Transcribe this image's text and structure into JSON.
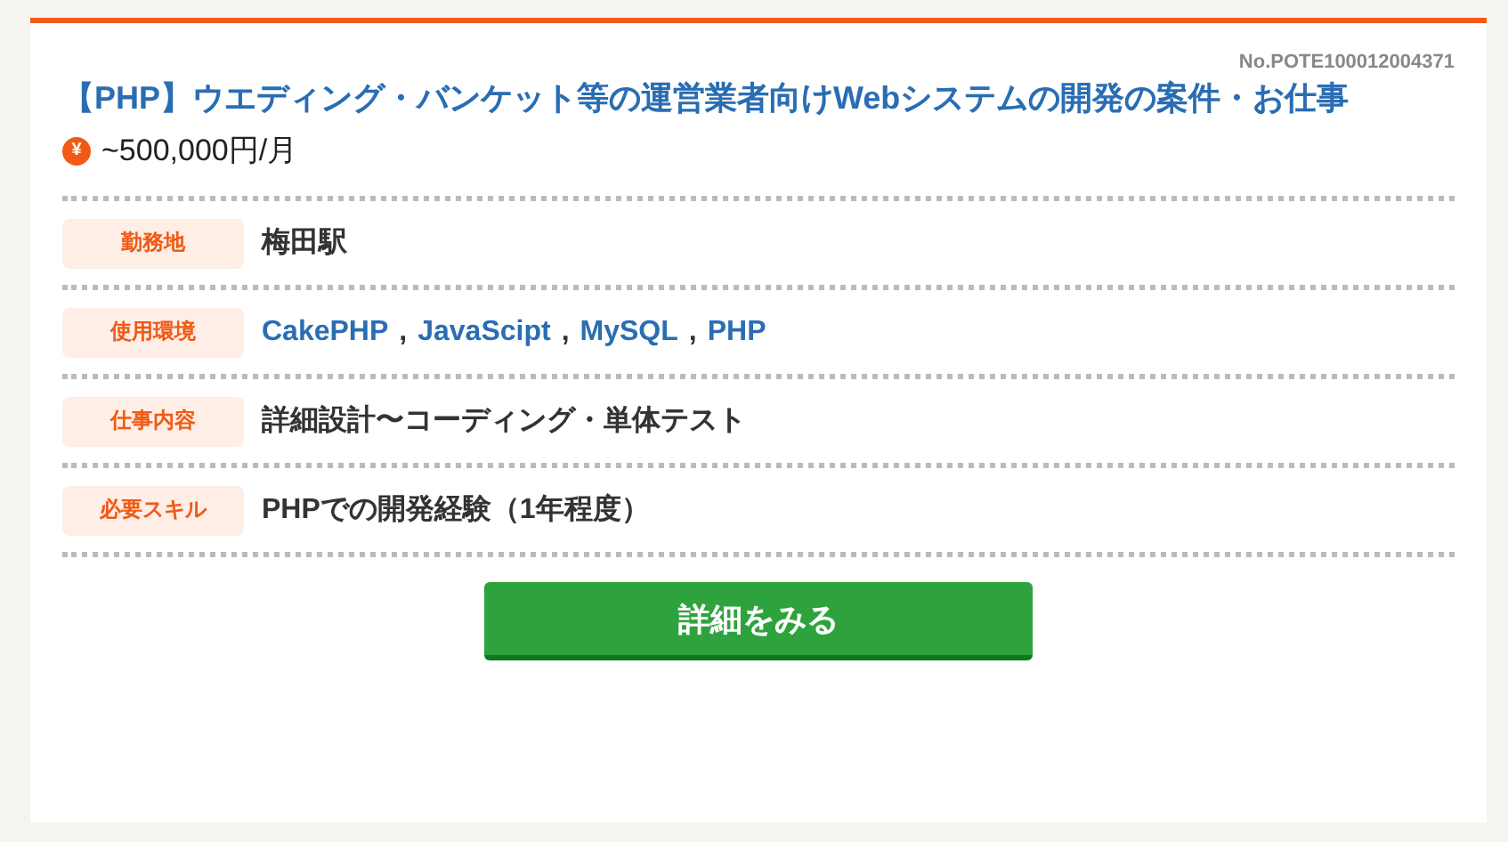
{
  "job_number": "No.POTE100012004371",
  "title": "【PHP】ウエディング・バンケット等の運営業者向けWebシステムの開発の案件・お仕事",
  "salary": {
    "icon": "¥",
    "amount": "~500,000円/月"
  },
  "rows": [
    {
      "label": "勤務地",
      "kind": "text",
      "value": "梅田駅"
    },
    {
      "label": "使用環境",
      "kind": "links",
      "links": [
        "CakePHP",
        "JavaScipt",
        "MySQL",
        "PHP"
      ],
      "separator": ","
    },
    {
      "label": "仕事内容",
      "kind": "text",
      "value": "詳細設計〜コーディング・単体テスト"
    },
    {
      "label": "必要スキル",
      "kind": "text",
      "value": "PHPでの開発経験（1年程度）"
    }
  ],
  "button": "詳細をみる"
}
